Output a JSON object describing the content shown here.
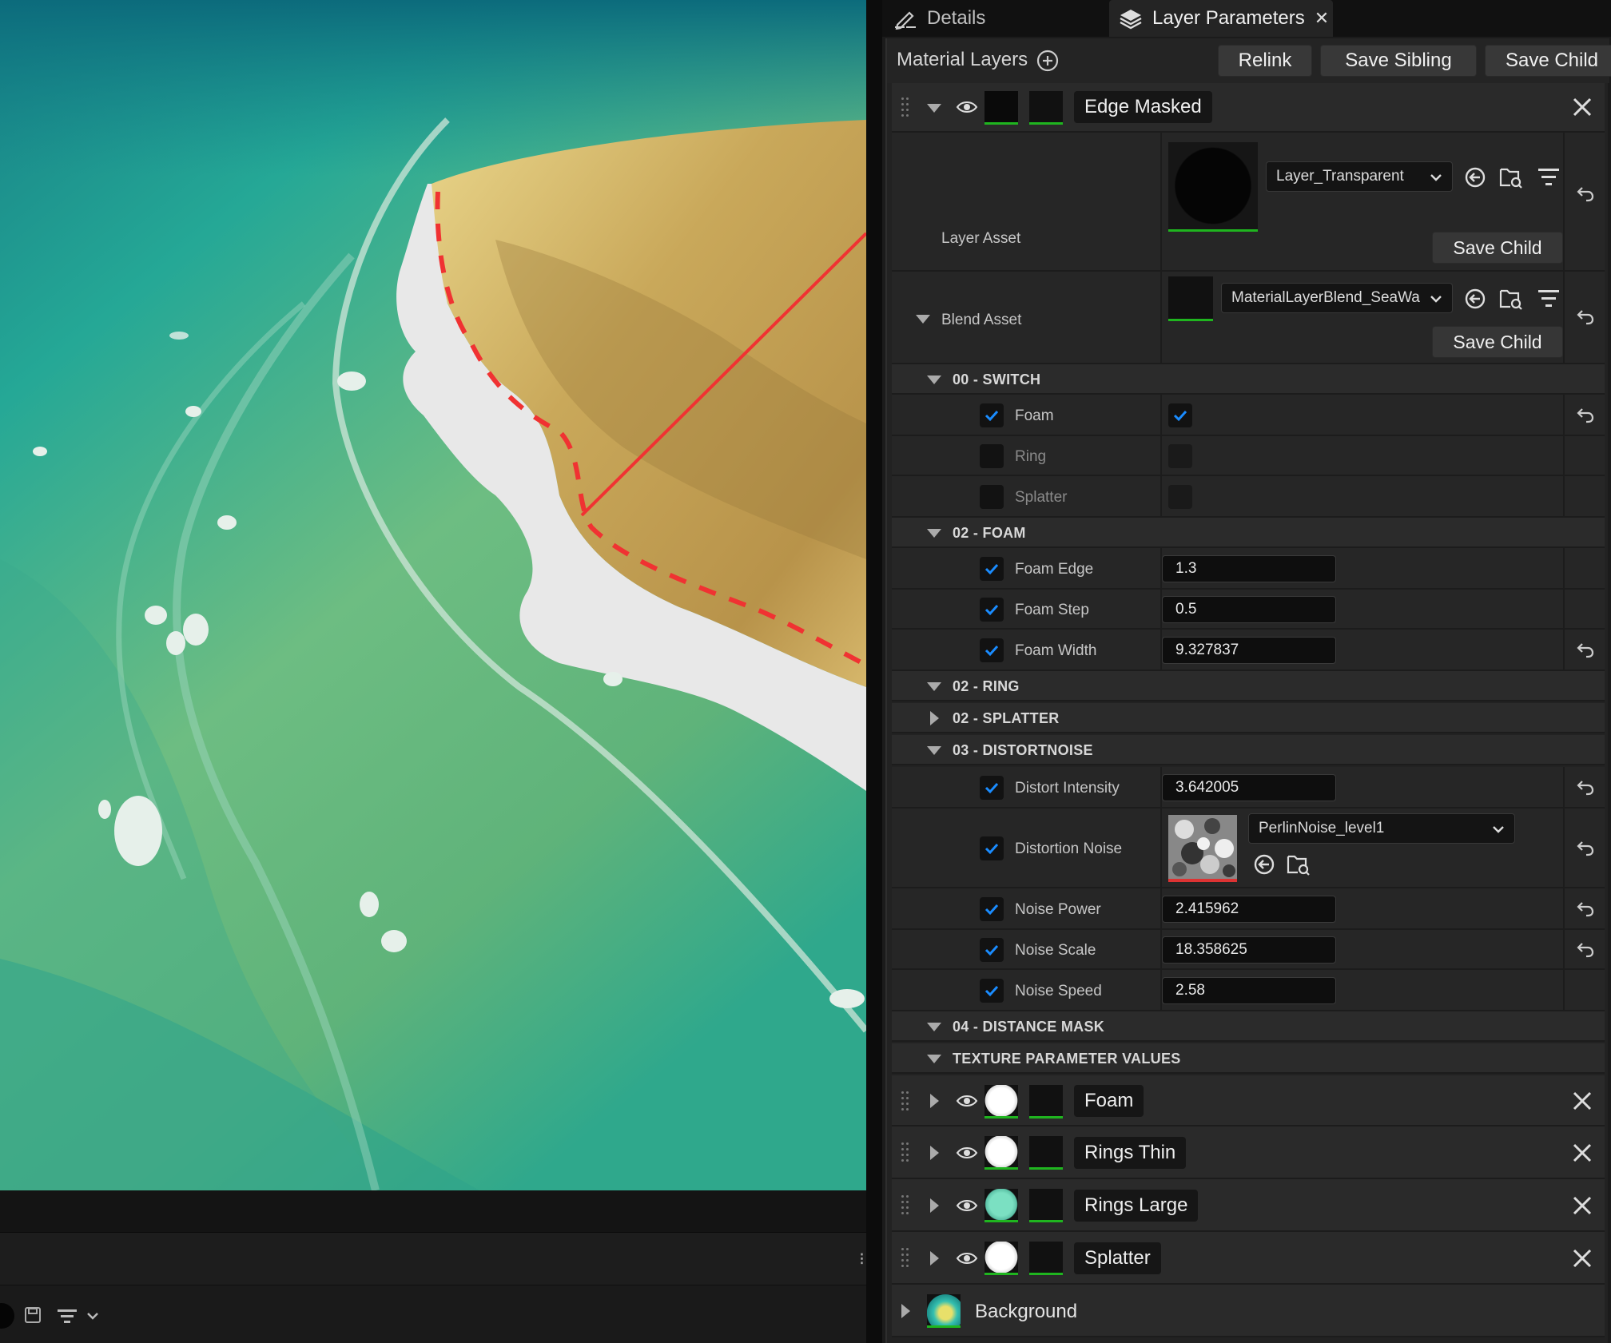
{
  "tabs": [
    {
      "label": "Details",
      "icon": "pencil-icon",
      "active": false
    },
    {
      "label": "Layer Parameters",
      "icon": "layers-icon",
      "active": true
    }
  ],
  "material_layers": {
    "title": "Material Layers",
    "buttons": {
      "relink": "Relink",
      "save_sibling": "Save Sibling",
      "save_child": "Save Child"
    }
  },
  "top_layer": {
    "name": "Edge Masked"
  },
  "layer_asset": {
    "label": "Layer Asset",
    "value": "Layer_Transparent",
    "save_child": "Save Child"
  },
  "blend_asset": {
    "label": "Blend Asset",
    "value": "MaterialLayerBlend_SeaWa",
    "save_child": "Save Child"
  },
  "groups": {
    "switch": "00 - SWITCH",
    "foam": "02 - FOAM",
    "ring": "02 - RING",
    "splatter": "02 - SPLATTER",
    "distortnoise": "03 - DISTORTNOISE",
    "distance_mask": "04 - DISTANCE MASK",
    "texture_params": "TEXTURE PARAMETER VALUES"
  },
  "switch_params": [
    {
      "label": "Foam",
      "enabled": true,
      "value": true
    },
    {
      "label": "Ring",
      "enabled": false,
      "value": false
    },
    {
      "label": "Splatter",
      "enabled": false,
      "value": false
    }
  ],
  "foam_params": [
    {
      "label": "Foam Edge",
      "value": "1.3"
    },
    {
      "label": "Foam Step",
      "value": "0.5"
    },
    {
      "label": "Foam Width",
      "value": "9.327837"
    }
  ],
  "noise_params": {
    "distort_intensity": {
      "label": "Distort Intensity",
      "value": "3.642005"
    },
    "distortion_noise": {
      "label": "Distortion Noise",
      "value": "PerlinNoise_level1"
    },
    "noise_power": {
      "label": "Noise Power",
      "value": "2.415962"
    },
    "noise_scale": {
      "label": "Noise Scale",
      "value": "18.358625"
    },
    "noise_speed": {
      "label": "Noise Speed",
      "value": "2.58"
    }
  },
  "sub_layers": [
    {
      "name": "Foam",
      "thumb": "white"
    },
    {
      "name": "Rings Thin",
      "thumb": "white"
    },
    {
      "name": "Rings Large",
      "thumb": "teal"
    },
    {
      "name": "Splatter",
      "thumb": "white"
    }
  ],
  "background_layer": {
    "name": "Background"
  },
  "colors": {
    "accent_check": "#1a8cff",
    "asset_underline": "#1fb51f",
    "annotation": "#f03232"
  }
}
